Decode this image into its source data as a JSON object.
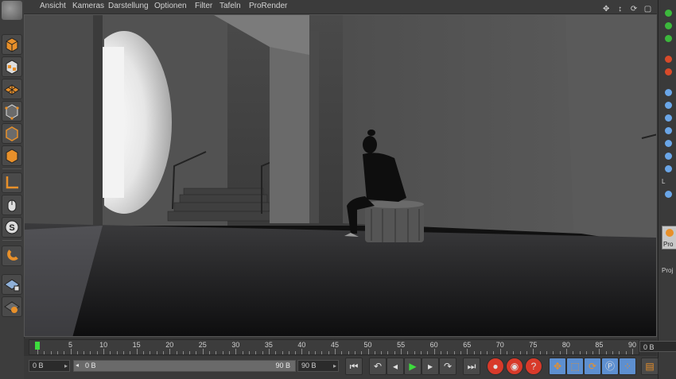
{
  "menu": {
    "items": [
      "Ansicht",
      "Kameras",
      "Darstellung",
      "Optionen",
      "Filter",
      "Tafeln",
      "ProRender"
    ]
  },
  "viewport_icons": [
    "move-view-icon",
    "rotate-view-icon",
    "zoom-view-icon",
    "maximize-view-icon"
  ],
  "timeline": {
    "ticks": [
      0,
      5,
      10,
      15,
      20,
      25,
      30,
      35,
      40,
      45,
      50,
      55,
      60,
      65,
      70,
      75,
      80,
      85,
      90
    ],
    "max_frame": 90,
    "current_frame": 0,
    "end_field": "0 B"
  },
  "transport": {
    "start_field": "0 B",
    "range_start": "0 B",
    "range_end": "90 B",
    "end_field": "90 B"
  },
  "right_panel": {
    "tab_label": "Pro",
    "proj_label": "Proj",
    "l_label": "L"
  },
  "colors": {
    "accent_orange": "#e8902a",
    "playhead_green": "#3ddc3d",
    "record_red": "#d83a2a"
  }
}
